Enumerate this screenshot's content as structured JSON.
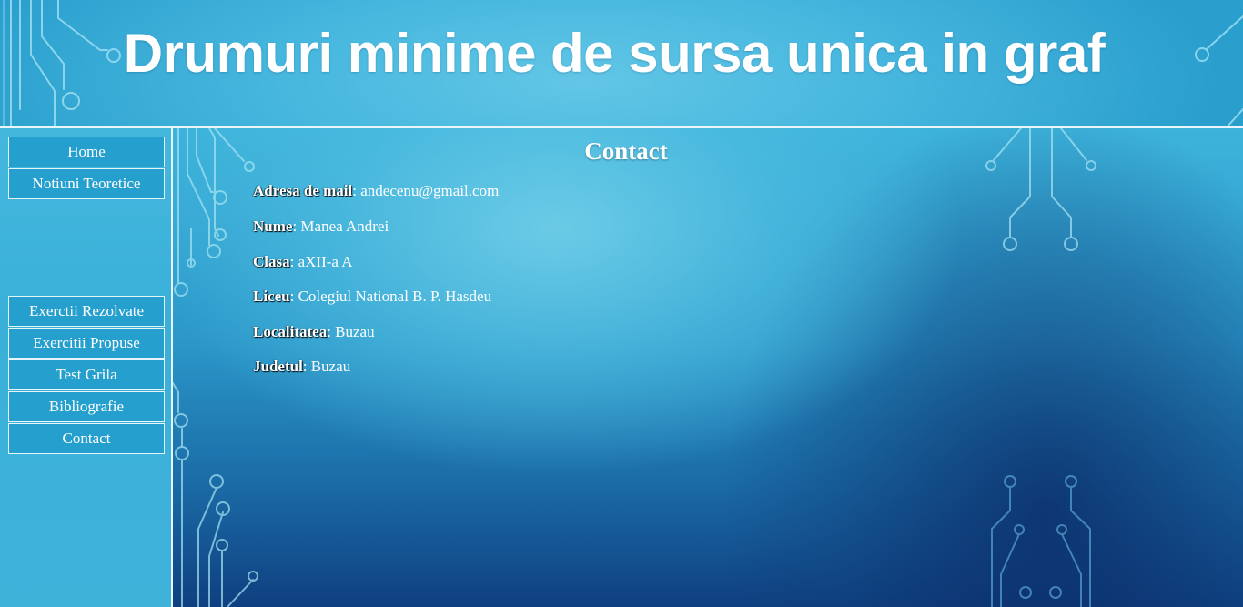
{
  "header": {
    "title": "Drumuri minime de sursa unica in graf"
  },
  "sidebar": {
    "items": [
      {
        "label": "Home"
      },
      {
        "label": "Notiuni Teoretice"
      },
      {
        "label": "Exerctii Rezolvate"
      },
      {
        "label": "Exercitii Propuse"
      },
      {
        "label": "Test Grila"
      },
      {
        "label": "Bibliografie"
      },
      {
        "label": "Contact"
      }
    ]
  },
  "main": {
    "title": "Contact",
    "rows": [
      {
        "label": "Adresa de mail",
        "value": ": andecenu@gmail.com"
      },
      {
        "label": "Nume",
        "value": ": Manea Andrei"
      },
      {
        "label": "Clasa",
        "value": ": aXII-a A"
      },
      {
        "label": "Liceu",
        "value": ": Colegiul National B. P. Hasdeu"
      },
      {
        "label": "Localitatea",
        "value": ": Buzau"
      },
      {
        "label": "Judetul",
        "value": ": Buzau"
      }
    ]
  },
  "colors": {
    "header_bg": "#48b8df",
    "nav_button_bg": "#259fcd",
    "border": "#e9f6fb",
    "text": "#ffffff",
    "circuit_stroke": "#a8e6f5"
  },
  "icons": {
    "decoration": "circuit-pattern-icon"
  }
}
